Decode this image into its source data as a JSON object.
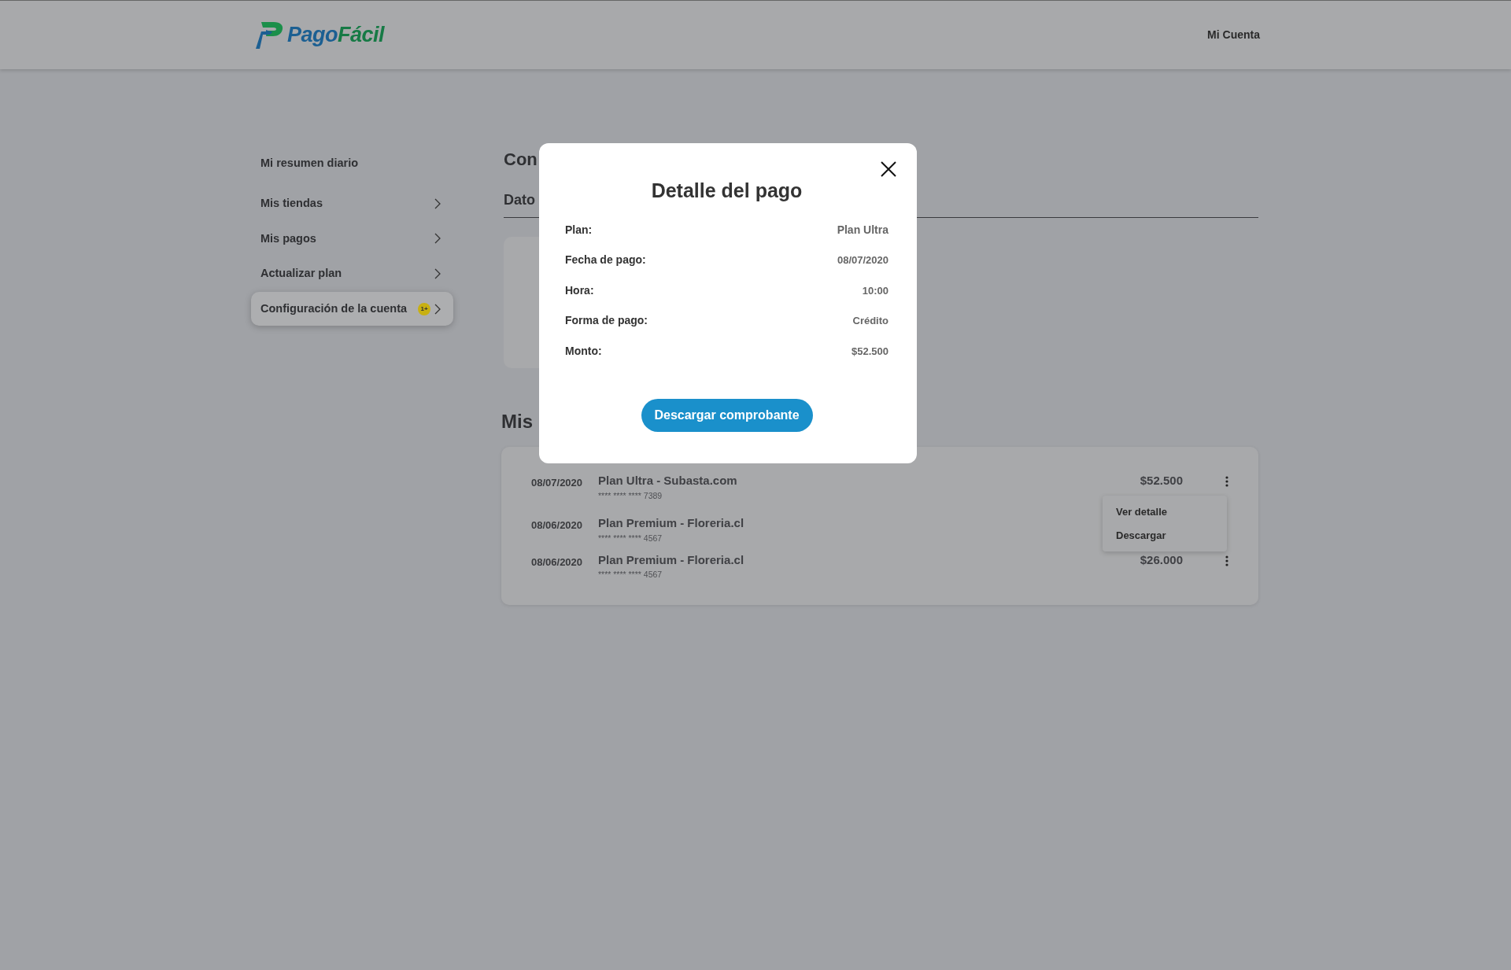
{
  "header": {
    "logo": {
      "first": "Pago",
      "second": "Fácil"
    },
    "account_link": "Mi Cuenta"
  },
  "sidebar": {
    "items": [
      {
        "label": "Mi resumen diario",
        "chevron": false,
        "selected": false
      },
      {
        "label": "Mis tiendas",
        "chevron": true,
        "selected": false
      },
      {
        "label": "Mis pagos",
        "chevron": true,
        "selected": false
      },
      {
        "label": "Actualizar plan",
        "chevron": true,
        "selected": false
      },
      {
        "label": "Configuración de la cuenta",
        "badge": "1+",
        "chevron": true,
        "selected": true
      }
    ]
  },
  "background_content": {
    "title": "Con",
    "section": "Dato",
    "payments_title": "Mis"
  },
  "payments": [
    {
      "date": "08/07/2020",
      "title": "Plan Ultra - Subasta.com",
      "card_number": "**** **** **** 7389",
      "amount": "$52.500"
    },
    {
      "date": "08/06/2020",
      "title": "Plan Premium - Floreria.cl",
      "card_number": "**** **** **** 4567"
    },
    {
      "date": "08/06/2020",
      "title": "Plan Premium - Floreria.cl",
      "card_number": "**** **** **** 4567",
      "amount": "$26.000"
    }
  ],
  "row_menu": {
    "items": [
      "Ver detalle",
      "Descargar"
    ]
  },
  "modal": {
    "title": "Detalle del pago",
    "fields": [
      {
        "label": "Plan:",
        "value": "Plan Ultra"
      },
      {
        "label": "Fecha de pago:",
        "value": "08/07/2020"
      },
      {
        "label": "Hora:",
        "value": "10:00"
      },
      {
        "label": "Forma de pago:",
        "value": "Crédito"
      },
      {
        "label": "Monto:",
        "value": "$52.500"
      }
    ],
    "button": "Descargar comprobante"
  }
}
